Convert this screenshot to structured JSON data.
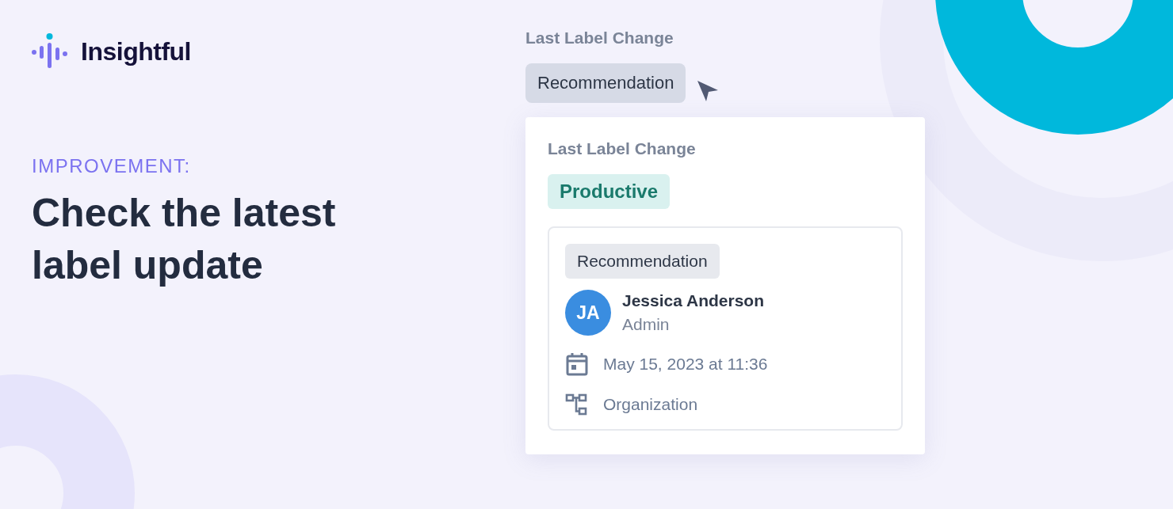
{
  "logo": {
    "text": "Insightful"
  },
  "headline": {
    "tag": "IMPROVEMENT:",
    "title": "Check the latest label update"
  },
  "field": {
    "label": "Last Label Change",
    "value": "Recommendation"
  },
  "popover": {
    "label": "Last Label Change",
    "label_value": "Productive",
    "change": {
      "badge": "Recommendation",
      "user": {
        "initials": "JA",
        "name": "Jessica Anderson",
        "role": "Admin"
      },
      "details": [
        {
          "kind": "date",
          "text": "May 15, 2023 at 11:36"
        },
        {
          "kind": "scope",
          "text": "Organization"
        }
      ]
    }
  }
}
